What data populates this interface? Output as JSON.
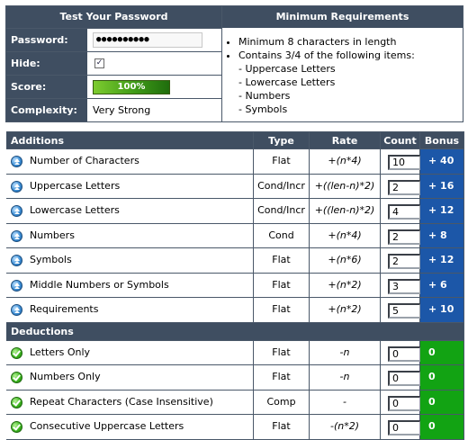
{
  "test_panel": {
    "title": "Test Your Password",
    "password_label": "Password:",
    "password_value": "●●●●●●●●●●",
    "hide_label": "Hide:",
    "hide_checked": "✓",
    "score_label": "Score:",
    "score_value": "100%",
    "score_fill": 1.0,
    "complexity_label": "Complexity:",
    "complexity_value": "Very Strong"
  },
  "requirements": {
    "title": "Minimum Requirements",
    "items": [
      "Minimum 8 characters in length",
      "Contains 3/4 of the following items:"
    ],
    "sub_items": [
      "- Uppercase Letters",
      "- Lowercase Letters",
      "- Numbers",
      "- Symbols"
    ]
  },
  "table": {
    "headers": {
      "name": "Additions",
      "type": "Type",
      "rate": "Rate",
      "count": "Count",
      "bonus": "Bonus"
    },
    "additions": [
      {
        "name": "Number of Characters",
        "type": "Flat",
        "rate": "+(n*4)",
        "count": "10",
        "bonus": "+ 40"
      },
      {
        "name": "Uppercase Letters",
        "type": "Cond/Incr",
        "rate": "+((len-n)*2)",
        "count": "2",
        "bonus": "+ 16"
      },
      {
        "name": "Lowercase Letters",
        "type": "Cond/Incr",
        "rate": "+((len-n)*2)",
        "count": "4",
        "bonus": "+ 12"
      },
      {
        "name": "Numbers",
        "type": "Cond",
        "rate": "+(n*4)",
        "count": "2",
        "bonus": "+ 8"
      },
      {
        "name": "Symbols",
        "type": "Flat",
        "rate": "+(n*6)",
        "count": "2",
        "bonus": "+ 12"
      },
      {
        "name": "Middle Numbers or Symbols",
        "type": "Flat",
        "rate": "+(n*2)",
        "count": "3",
        "bonus": "+ 6"
      },
      {
        "name": "Requirements",
        "type": "Flat",
        "rate": "+(n*2)",
        "count": "5",
        "bonus": "+ 10"
      }
    ],
    "deductions_label": "Deductions",
    "deductions": [
      {
        "name": "Letters Only",
        "type": "Flat",
        "rate": "-n",
        "count": "0",
        "bonus": "0"
      },
      {
        "name": "Numbers Only",
        "type": "Flat",
        "rate": "-n",
        "count": "0",
        "bonus": "0"
      },
      {
        "name": "Repeat Characters (Case Insensitive)",
        "type": "Comp",
        "rate": "-",
        "count": "0",
        "bonus": "0"
      },
      {
        "name": "Consecutive Uppercase Letters",
        "type": "Flat",
        "rate": "-(n*2)",
        "count": "0",
        "bonus": "0"
      }
    ]
  },
  "colors": {
    "header_bg": "#3f4e61",
    "bonus_blue": "#1c57a8",
    "bonus_green": "#12a313"
  }
}
